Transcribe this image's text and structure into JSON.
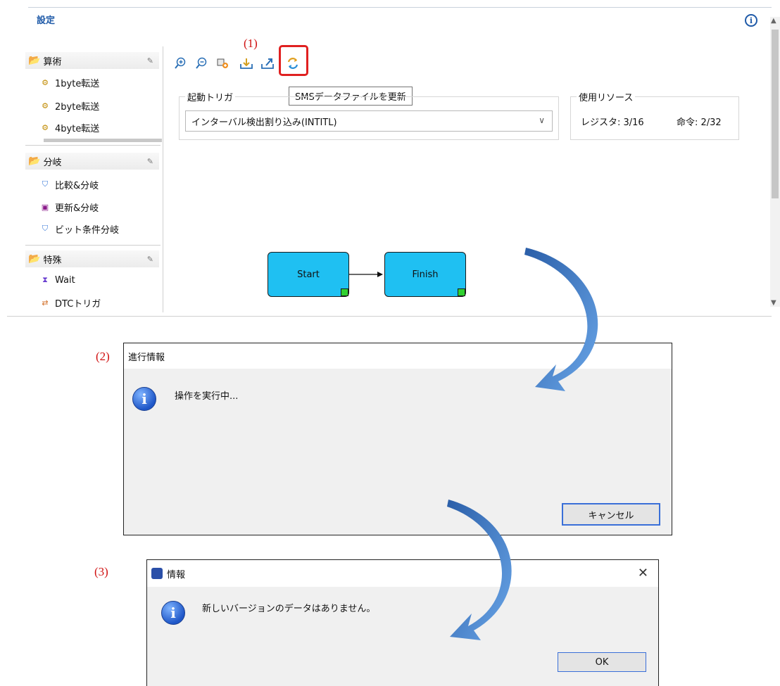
{
  "editor": {
    "title": "設定",
    "info_glyph": "i"
  },
  "palette": {
    "sections": [
      {
        "name": "算術",
        "items": [
          {
            "label": "1byte転送",
            "icon": "gear-icon"
          },
          {
            "label": "2byte転送",
            "icon": "gear-icon"
          },
          {
            "label": "4byte転送",
            "icon": "gear-icon"
          }
        ]
      },
      {
        "name": "分岐",
        "items": [
          {
            "label": "比較&分岐",
            "icon": "compare-branch-icon"
          },
          {
            "label": "更新&分岐",
            "icon": "update-branch-icon"
          },
          {
            "label": "ビット条件分岐",
            "icon": "bit-branch-icon"
          }
        ]
      },
      {
        "name": "特殊",
        "items": [
          {
            "label": "Wait",
            "icon": "hourglass-icon"
          },
          {
            "label": "DTCトリガ",
            "icon": "dtc-trigger-icon"
          }
        ]
      }
    ]
  },
  "toolbar": {
    "step_label": "(1)",
    "tooltip": "SMSデータファイルを更新"
  },
  "trigger": {
    "title": "起動トリガ",
    "selected": "インターバル検出割り込み(INTITL)"
  },
  "resources": {
    "title": "使用リソース",
    "registers": "レジスタ: 3/16",
    "instructions": "命令: 2/32"
  },
  "flow": {
    "start": "Start",
    "finish": "Finish"
  },
  "progress_dialog": {
    "step_label": "(2)",
    "title": "進行情報",
    "message": "操作を実行中...",
    "cancel": "キャンセル"
  },
  "info_dialog": {
    "step_label": "(3)",
    "title": "情報",
    "message": "新しいバージョンのデータはありません。",
    "ok": "OK",
    "close": "✕"
  },
  "colors": {
    "node_fill": "#1fc0f2",
    "highlight": "#e02020",
    "step_label": "#d01010",
    "arrow": "#2f6db8"
  }
}
